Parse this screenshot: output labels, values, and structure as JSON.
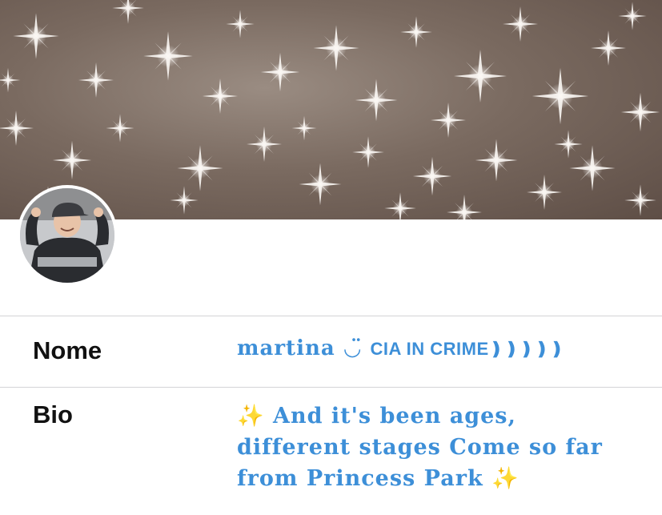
{
  "profile": {
    "fields": [
      {
        "label": "Nome",
        "value_main": "martina ◡̈ ",
        "value_caps": "CIA IN CRIME❫❫❫❫❫"
      },
      {
        "label": "Bio",
        "value": "And it's been ages, different stages Come so far from Princess Park"
      }
    ],
    "bio_prefix_icon": "sparkles-icon",
    "bio_suffix_icon": "sparkles-icon"
  },
  "colors": {
    "accent_text": "#3d8fd8",
    "label_text": "#111111",
    "divider": "#d3d3d6",
    "header_bg": "#7a6a60"
  },
  "icons": [
    "sparkles-icon",
    "avatar"
  ]
}
